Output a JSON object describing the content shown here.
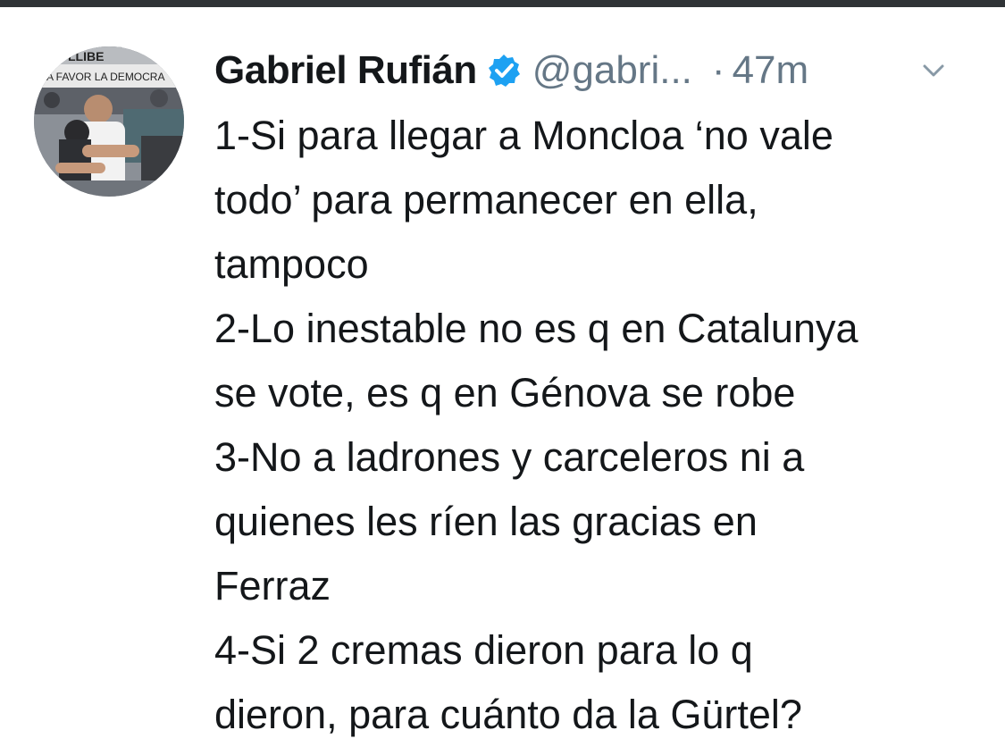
{
  "tweet": {
    "author": {
      "display_name": "Gabriel Rufián",
      "handle": "@gabri...",
      "verified": true,
      "avatar_icon": "profile-photo"
    },
    "timestamp": "47m",
    "separator": "·",
    "menu_icon": "chevron-down-icon",
    "text_lines": [
      "1-Si para llegar a Moncloa ‘no vale",
      "todo’ para permanecer en ella,",
      "tampoco",
      "2-Lo inestable no es q en Catalunya",
      "se vote, es q en Génova se robe",
      "3-No a ladrones y carceleros ni a",
      "quienes les ríen las gracias en",
      "Ferraz",
      "4-Si 2 cremas dieron para lo q",
      "dieron, para cuánto da la Gürtel?"
    ],
    "avatar_banner_text": {
      "line1": "LLIBE",
      "line2": "A FAVOR LA DEMOCRA"
    }
  },
  "colors": {
    "text_primary": "#14171a",
    "text_secondary": "#657786",
    "verified_blue": "#1da1f2",
    "top_bar": "#2f3336"
  }
}
